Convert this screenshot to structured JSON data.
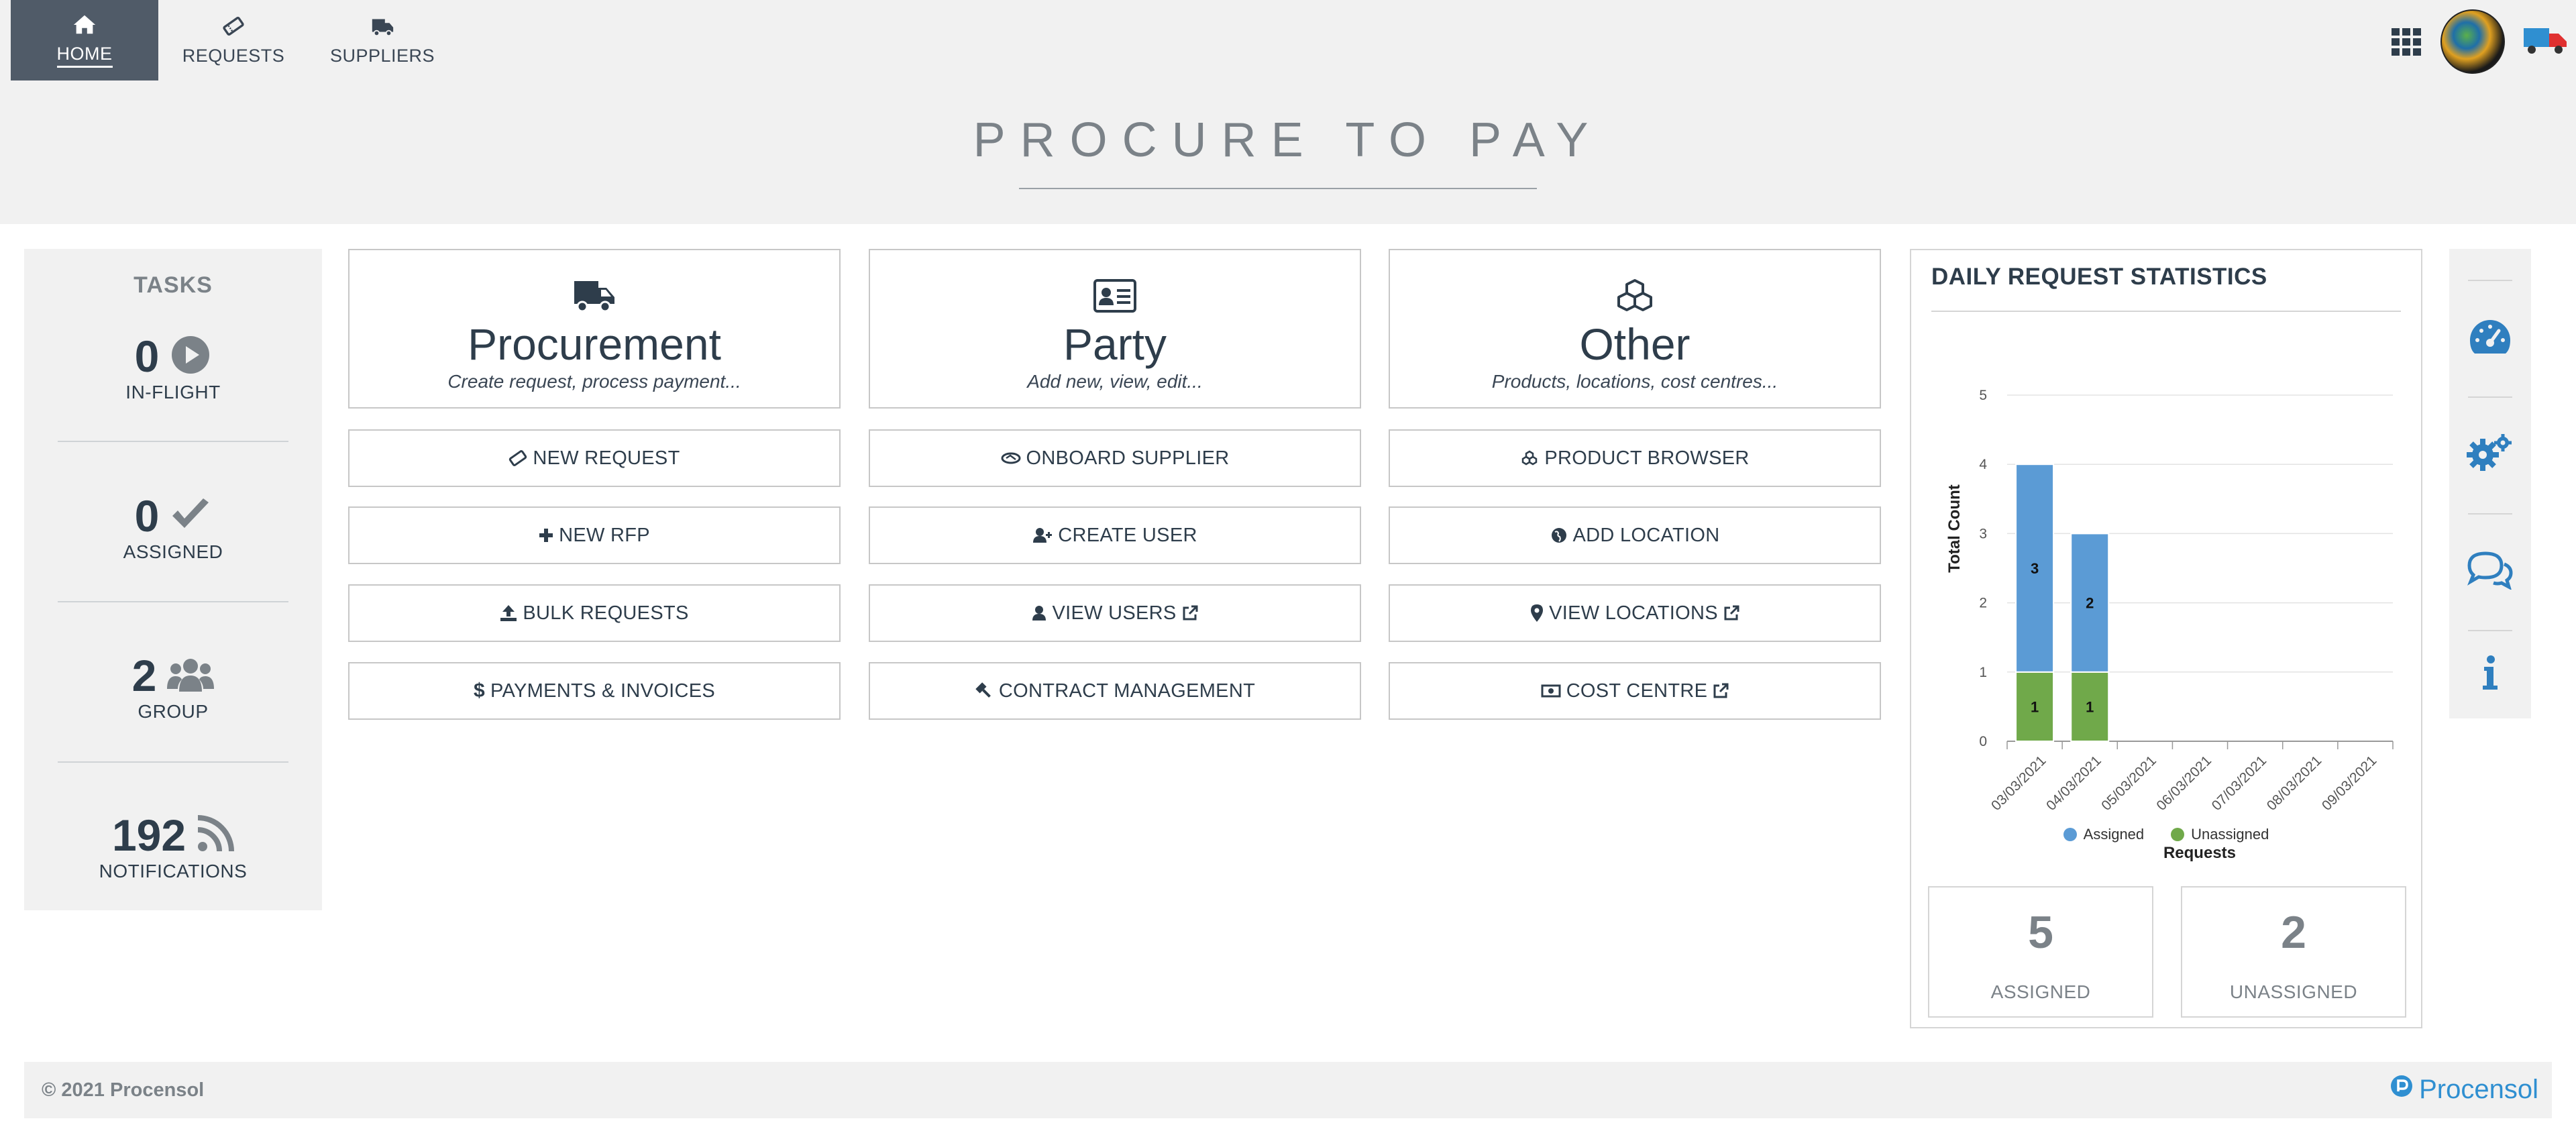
{
  "nav": {
    "items": [
      {
        "label": "HOME",
        "icon": "home-icon"
      },
      {
        "label": "REQUESTS",
        "icon": "ticket-icon"
      },
      {
        "label": "SUPPLIERS",
        "icon": "truck-icon"
      }
    ]
  },
  "title": "PROCURE TO PAY",
  "tasks": {
    "title": "TASKS",
    "stats": [
      {
        "value": "0",
        "label": "IN-FLIGHT",
        "icon": "play-circle-icon"
      },
      {
        "value": "0",
        "label": "ASSIGNED",
        "icon": "check-icon"
      },
      {
        "value": "2",
        "label": "GROUP",
        "icon": "users-icon"
      },
      {
        "value": "192",
        "label": "NOTIFICATIONS",
        "icon": "rss-icon"
      }
    ]
  },
  "cards": [
    {
      "title": "Procurement",
      "subtitle": "Create request, process payment...",
      "icon": "truck-icon"
    },
    {
      "title": "Party",
      "subtitle": "Add new, view, edit...",
      "icon": "id-card-icon"
    },
    {
      "title": "Other",
      "subtitle": "Products, locations, cost centres...",
      "icon": "cubes-icon"
    }
  ],
  "actions": {
    "procurement": [
      "NEW REQUEST",
      "NEW RFP",
      "BULK REQUESTS",
      "PAYMENTS & INVOICES"
    ],
    "party": [
      "ONBOARD SUPPLIER",
      "CREATE USER",
      "VIEW USERS",
      "CONTRACT MANAGEMENT"
    ],
    "other": [
      "PRODUCT BROWSER",
      "ADD LOCATION",
      "VIEW LOCATIONS",
      "COST CENTRE"
    ]
  },
  "stats_panel": {
    "title": "DAILY REQUEST STATISTICS",
    "kpis": [
      {
        "value": "5",
        "label": "ASSIGNED"
      },
      {
        "value": "2",
        "label": "UNASSIGNED"
      }
    ]
  },
  "chart_data": {
    "type": "bar",
    "stacked": true,
    "title": "",
    "xlabel": "Requests",
    "ylabel": "Total Count",
    "categories": [
      "03/03/2021",
      "04/03/2021",
      "05/03/2021",
      "06/03/2021",
      "07/03/2021",
      "08/03/2021",
      "09/03/2021"
    ],
    "series": [
      {
        "name": "Unassigned",
        "color": "#70a94a",
        "values": [
          1,
          1,
          0,
          0,
          0,
          0,
          0
        ]
      },
      {
        "name": "Assigned",
        "color": "#5b9bd5",
        "values": [
          3,
          2,
          0,
          0,
          0,
          0,
          0
        ]
      }
    ],
    "ylim": [
      0,
      5
    ],
    "yticks": [
      0,
      1,
      2,
      3,
      4,
      5
    ],
    "grid": true,
    "legend": "bottom"
  },
  "footer": {
    "copyright": "© 2021 Procensol",
    "brand": "Procensol"
  },
  "colors": {
    "nav_active": "#505b68",
    "panel_bg": "#f1f1f1",
    "text_dark": "#2e3d4b",
    "muted": "#7b8288",
    "brand": "#2f8fd1"
  }
}
